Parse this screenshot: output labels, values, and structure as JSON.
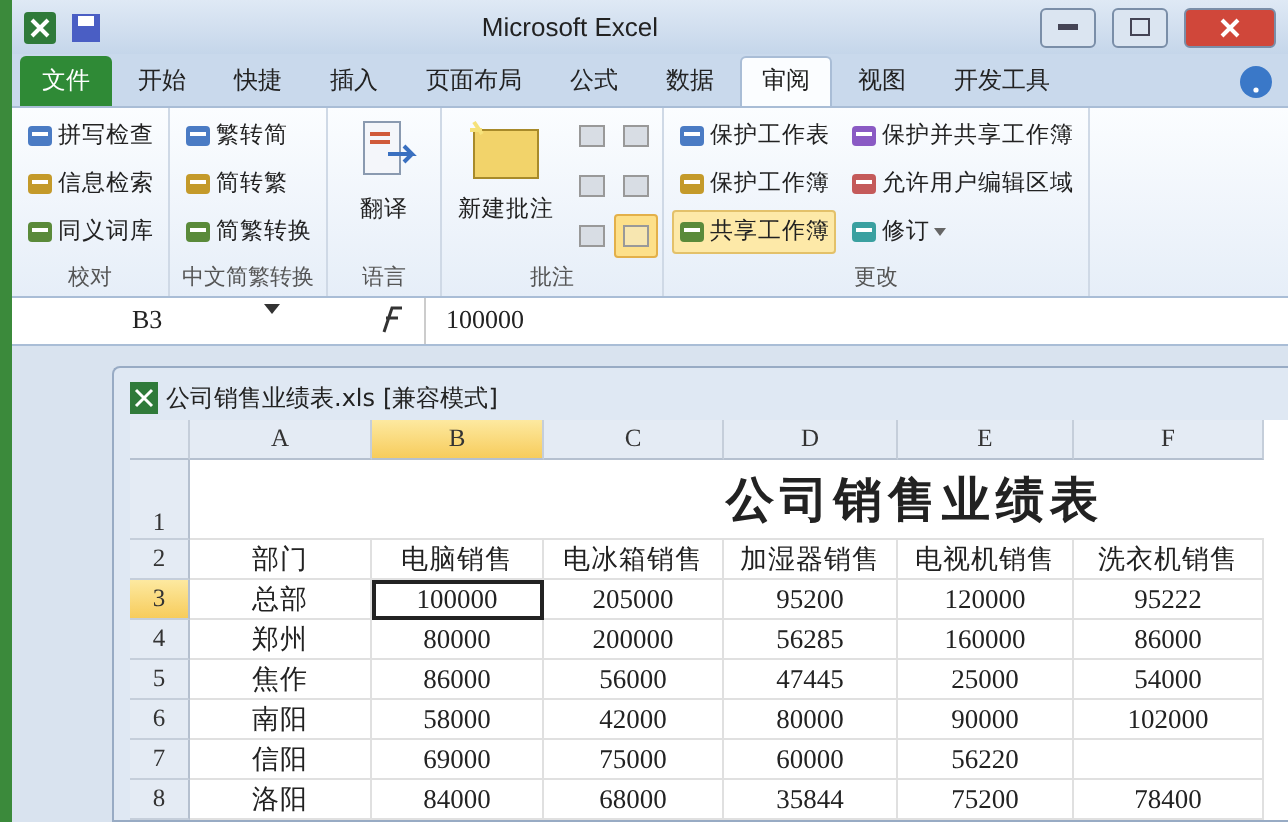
{
  "window": {
    "title": "Microsoft Excel"
  },
  "tabs": [
    {
      "label": "文件",
      "kind": "file",
      "selected": false
    },
    {
      "label": "开始",
      "kind": "tab",
      "selected": false
    },
    {
      "label": "快捷",
      "kind": "tab",
      "selected": false
    },
    {
      "label": "插入",
      "kind": "tab",
      "selected": false
    },
    {
      "label": "页面布局",
      "kind": "tab",
      "selected": false
    },
    {
      "label": "公式",
      "kind": "tab",
      "selected": false
    },
    {
      "label": "数据",
      "kind": "tab",
      "selected": false
    },
    {
      "label": "审阅",
      "kind": "tab",
      "selected": true
    },
    {
      "label": "视图",
      "kind": "tab",
      "selected": false
    },
    {
      "label": "开发工具",
      "kind": "tab",
      "selected": false
    }
  ],
  "ribbon_groups": [
    {
      "label": "校对",
      "kind": "small",
      "items": [
        {
          "label": "拼写检查",
          "highlighted": false
        },
        {
          "label": "信息检索",
          "highlighted": false
        },
        {
          "label": "同义词库",
          "highlighted": false
        }
      ]
    },
    {
      "label": "中文简繁转换",
      "kind": "small",
      "items": [
        {
          "label": "繁转简",
          "highlighted": false
        },
        {
          "label": "简转繁",
          "highlighted": false
        },
        {
          "label": "简繁转换",
          "highlighted": false
        }
      ]
    },
    {
      "label": "语言",
      "kind": "large",
      "items": [
        {
          "label": "翻译",
          "highlighted": false
        }
      ]
    },
    {
      "label": "批注",
      "kind": "comments",
      "items": [
        {
          "label": "新建批注",
          "highlighted": false
        }
      ],
      "icon_buttons": [
        {
          "highlighted": false
        },
        {
          "highlighted": false
        },
        {
          "highlighted": false
        },
        {
          "highlighted": false
        },
        {
          "highlighted": false
        },
        {
          "highlighted": true
        }
      ]
    },
    {
      "label": "更改",
      "kind": "columns",
      "items": [
        {
          "label": "保护工作表",
          "highlighted": false
        },
        {
          "label": "保护工作簿",
          "highlighted": false
        },
        {
          "label": "共享工作簿",
          "highlighted": true
        },
        {
          "label": "保护并共享工作簿",
          "highlighted": false
        },
        {
          "label": "允许用户编辑区域",
          "highlighted": false
        },
        {
          "label": "修订",
          "highlighted": false,
          "dropdown": true
        }
      ]
    }
  ],
  "formula_bar": {
    "name_box": "B3",
    "formula": "100000"
  },
  "workbook": {
    "title": "公司销售业绩表.xls",
    "mode": "[兼容模式]",
    "columns": [
      {
        "label": "A",
        "selected": false
      },
      {
        "label": "B",
        "selected": true
      },
      {
        "label": "C",
        "selected": false
      },
      {
        "label": "D",
        "selected": false
      },
      {
        "label": "E",
        "selected": false
      },
      {
        "label": "F",
        "selected": false
      }
    ],
    "sheet_title": "公司销售业绩表",
    "rows": [
      {
        "number": "1",
        "selected": false,
        "kind": "title"
      },
      {
        "number": "2",
        "selected": false,
        "kind": "header",
        "cells": [
          "部门",
          "电脑销售",
          "电冰箱销售",
          "加湿器销售",
          "电视机销售",
          "洗衣机销售"
        ]
      },
      {
        "number": "3",
        "selected": true,
        "kind": "data",
        "cells": [
          "总部",
          "100000",
          "205000",
          "95200",
          "120000",
          "95222"
        ]
      },
      {
        "number": "4",
        "selected": false,
        "kind": "data",
        "cells": [
          "郑州",
          "80000",
          "200000",
          "56285",
          "160000",
          "86000"
        ]
      },
      {
        "number": "5",
        "selected": false,
        "kind": "data",
        "cells": [
          "焦作",
          "86000",
          "56000",
          "47445",
          "25000",
          "54000"
        ]
      },
      {
        "number": "6",
        "selected": false,
        "kind": "data",
        "cells": [
          "南阳",
          "58000",
          "42000",
          "80000",
          "90000",
          "102000"
        ]
      },
      {
        "number": "7",
        "selected": false,
        "kind": "data",
        "cells": [
          "信阳",
          "69000",
          "75000",
          "60000",
          "56220",
          null
        ]
      },
      {
        "number": "8",
        "selected": false,
        "kind": "data",
        "cells": [
          "洛阳",
          "84000",
          "68000",
          "35844",
          "75200",
          "78400"
        ]
      }
    ]
  }
}
